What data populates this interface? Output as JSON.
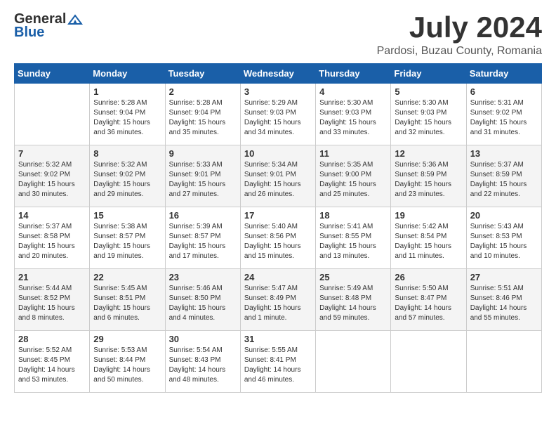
{
  "logo": {
    "general": "General",
    "blue": "Blue"
  },
  "title": {
    "month_year": "July 2024",
    "location": "Pardosi, Buzau County, Romania"
  },
  "calendar": {
    "headers": [
      "Sunday",
      "Monday",
      "Tuesday",
      "Wednesday",
      "Thursday",
      "Friday",
      "Saturday"
    ],
    "weeks": [
      [
        {
          "day": "",
          "info": ""
        },
        {
          "day": "1",
          "info": "Sunrise: 5:28 AM\nSunset: 9:04 PM\nDaylight: 15 hours\nand 36 minutes."
        },
        {
          "day": "2",
          "info": "Sunrise: 5:28 AM\nSunset: 9:04 PM\nDaylight: 15 hours\nand 35 minutes."
        },
        {
          "day": "3",
          "info": "Sunrise: 5:29 AM\nSunset: 9:03 PM\nDaylight: 15 hours\nand 34 minutes."
        },
        {
          "day": "4",
          "info": "Sunrise: 5:30 AM\nSunset: 9:03 PM\nDaylight: 15 hours\nand 33 minutes."
        },
        {
          "day": "5",
          "info": "Sunrise: 5:30 AM\nSunset: 9:03 PM\nDaylight: 15 hours\nand 32 minutes."
        },
        {
          "day": "6",
          "info": "Sunrise: 5:31 AM\nSunset: 9:02 PM\nDaylight: 15 hours\nand 31 minutes."
        }
      ],
      [
        {
          "day": "7",
          "info": "Sunrise: 5:32 AM\nSunset: 9:02 PM\nDaylight: 15 hours\nand 30 minutes."
        },
        {
          "day": "8",
          "info": "Sunrise: 5:32 AM\nSunset: 9:02 PM\nDaylight: 15 hours\nand 29 minutes."
        },
        {
          "day": "9",
          "info": "Sunrise: 5:33 AM\nSunset: 9:01 PM\nDaylight: 15 hours\nand 27 minutes."
        },
        {
          "day": "10",
          "info": "Sunrise: 5:34 AM\nSunset: 9:01 PM\nDaylight: 15 hours\nand 26 minutes."
        },
        {
          "day": "11",
          "info": "Sunrise: 5:35 AM\nSunset: 9:00 PM\nDaylight: 15 hours\nand 25 minutes."
        },
        {
          "day": "12",
          "info": "Sunrise: 5:36 AM\nSunset: 8:59 PM\nDaylight: 15 hours\nand 23 minutes."
        },
        {
          "day": "13",
          "info": "Sunrise: 5:37 AM\nSunset: 8:59 PM\nDaylight: 15 hours\nand 22 minutes."
        }
      ],
      [
        {
          "day": "14",
          "info": "Sunrise: 5:37 AM\nSunset: 8:58 PM\nDaylight: 15 hours\nand 20 minutes."
        },
        {
          "day": "15",
          "info": "Sunrise: 5:38 AM\nSunset: 8:57 PM\nDaylight: 15 hours\nand 19 minutes."
        },
        {
          "day": "16",
          "info": "Sunrise: 5:39 AM\nSunset: 8:57 PM\nDaylight: 15 hours\nand 17 minutes."
        },
        {
          "day": "17",
          "info": "Sunrise: 5:40 AM\nSunset: 8:56 PM\nDaylight: 15 hours\nand 15 minutes."
        },
        {
          "day": "18",
          "info": "Sunrise: 5:41 AM\nSunset: 8:55 PM\nDaylight: 15 hours\nand 13 minutes."
        },
        {
          "day": "19",
          "info": "Sunrise: 5:42 AM\nSunset: 8:54 PM\nDaylight: 15 hours\nand 11 minutes."
        },
        {
          "day": "20",
          "info": "Sunrise: 5:43 AM\nSunset: 8:53 PM\nDaylight: 15 hours\nand 10 minutes."
        }
      ],
      [
        {
          "day": "21",
          "info": "Sunrise: 5:44 AM\nSunset: 8:52 PM\nDaylight: 15 hours\nand 8 minutes."
        },
        {
          "day": "22",
          "info": "Sunrise: 5:45 AM\nSunset: 8:51 PM\nDaylight: 15 hours\nand 6 minutes."
        },
        {
          "day": "23",
          "info": "Sunrise: 5:46 AM\nSunset: 8:50 PM\nDaylight: 15 hours\nand 4 minutes."
        },
        {
          "day": "24",
          "info": "Sunrise: 5:47 AM\nSunset: 8:49 PM\nDaylight: 15 hours\nand 1 minute."
        },
        {
          "day": "25",
          "info": "Sunrise: 5:49 AM\nSunset: 8:48 PM\nDaylight: 14 hours\nand 59 minutes."
        },
        {
          "day": "26",
          "info": "Sunrise: 5:50 AM\nSunset: 8:47 PM\nDaylight: 14 hours\nand 57 minutes."
        },
        {
          "day": "27",
          "info": "Sunrise: 5:51 AM\nSunset: 8:46 PM\nDaylight: 14 hours\nand 55 minutes."
        }
      ],
      [
        {
          "day": "28",
          "info": "Sunrise: 5:52 AM\nSunset: 8:45 PM\nDaylight: 14 hours\nand 53 minutes."
        },
        {
          "day": "29",
          "info": "Sunrise: 5:53 AM\nSunset: 8:44 PM\nDaylight: 14 hours\nand 50 minutes."
        },
        {
          "day": "30",
          "info": "Sunrise: 5:54 AM\nSunset: 8:43 PM\nDaylight: 14 hours\nand 48 minutes."
        },
        {
          "day": "31",
          "info": "Sunrise: 5:55 AM\nSunset: 8:41 PM\nDaylight: 14 hours\nand 46 minutes."
        },
        {
          "day": "",
          "info": ""
        },
        {
          "day": "",
          "info": ""
        },
        {
          "day": "",
          "info": ""
        }
      ]
    ]
  }
}
